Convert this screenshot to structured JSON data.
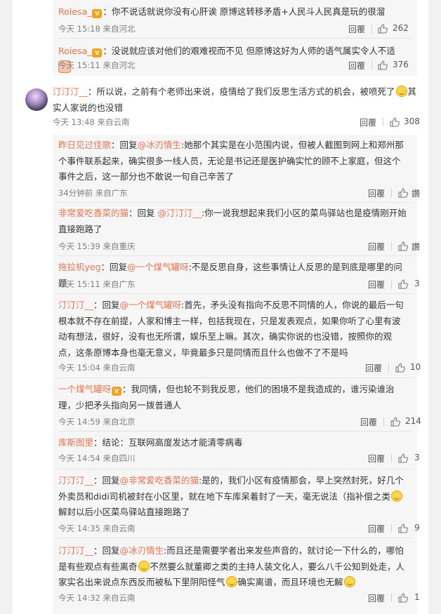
{
  "ui": {
    "reply_label": "回覆",
    "reply_emblem": "V"
  },
  "top_replies": [
    {
      "user": "Roiesa_",
      "text": "：你不说话就说你没有心肝诶 原博这转移矛盾+人民斗人民真是玩的很溜",
      "time": "今天 15:18 来自河北",
      "likes": "262"
    },
    {
      "user": "Roiesa_",
      "text": "：没说就应该对他们的艰难视而不见 但原博这好为人师的语气属实令人不适",
      "time": "今天 15:11 来自河北",
      "likes": "376"
    }
  ],
  "main_comment": {
    "user": "汀汀汀__",
    "text_a": "：所以说，之前有个老师出来说，疫情给了我们反思生活方式的机会，被喷死了",
    "text_b": "其实人家说的也没错",
    "time": "今天 13:48 来自云南",
    "likes": "308"
  },
  "sub_replies": [
    {
      "user": "昨日见过佳歌",
      "reply_prefix": "：回复",
      "mention": "@冰刃情生",
      "text": ":她那个其实是在小范围内说，但被人截图到网上和郑州那个事件联系起来，确实很多一线人员，无论是书记还是医护确实忙的顾不上家庭，但这个事件之后，这一部分也不敢说一句自己辛苦了",
      "time": "34分钟前 来自广东",
      "likes": "讚"
    },
    {
      "user": "非常爱吃香菜的猫",
      "reply_prefix": "：回复 ",
      "mention": "@汀汀汀__",
      "text": ":你一说我想起来我们小区的菜鸟驿站也是疫情刚开始直接跑路了",
      "time": "今天 15:39 来自重庆",
      "likes": "讚"
    },
    {
      "user": "拖拉机yeg",
      "reply_prefix": "：回复",
      "mention": "@一个煤气罐呀",
      "text": ":不是反思自身，这些事情让人反思的是到底是哪里的问题",
      "time": "今天 15:11 来自广东",
      "likes": "3"
    },
    {
      "user": "汀汀汀__",
      "reply_prefix": "：回复",
      "mention": "@一个煤气罐呀",
      "text": ":首先，矛头没有指向不反思不同情的人，你说的最后一句根本就不存在前提，人家和博主一样，包括我现在，只是发表观点，如果你听了心里有波动有想法，很好，没有也无所谓，娱乐至上嘛。其次，确实你说的也没错，按照你的观点，这条原博本身也毫无意义，毕竟最多只是同情而且什么也做不了不是吗",
      "time": "今天 15:04 来自云南",
      "likes": "10"
    },
    {
      "user": "一个煤气罐呀",
      "reply_prefix": "",
      "mention": "",
      "text": "：我同情，但也轮不到我反思，他们的困境不是我造成的，谁污染谁治理，少把矛头指向另一拨普通人",
      "time": "今天 14:59 来自北京",
      "likes": "214"
    },
    {
      "user": "库斯图里",
      "reply_prefix": "",
      "mention": "",
      "text": "：结论：互联网高度发达才能清零病毒",
      "time": "今天 14:54 来自四川",
      "likes": "3"
    },
    {
      "user": "汀汀汀__",
      "reply_prefix": "：回复",
      "mention": "@非常爱吃香菜的猫",
      "text_a": ":是的，我们小区有疫情那会，早上突然封死，好几个外卖员和didi司机被封在小区里，就在地下车库呆着封了一天，毫无说法（指补偿之类",
      "text_b": "解封以后小区菜鸟驿站直接跑路了",
      "time": "今天 14:35 来自云南",
      "likes": "9"
    },
    {
      "user": "汀汀汀__",
      "reply_prefix": "：回复",
      "mention": "@冰刃情生",
      "text_a": ":而且还是需要学者出来发些声音的，就讨论一下什么的，哪怕是有些观点有些离奇",
      "text_b": "不然要么就董卿之类的主持人装文化人，要么八千公知到处走，人家实名出来说点东西反而被私下里阴阳怪气",
      "text_c": "确实离谱，而且环境也无解",
      "time": "今天 14:32 来自云南",
      "likes": "1"
    }
  ]
}
